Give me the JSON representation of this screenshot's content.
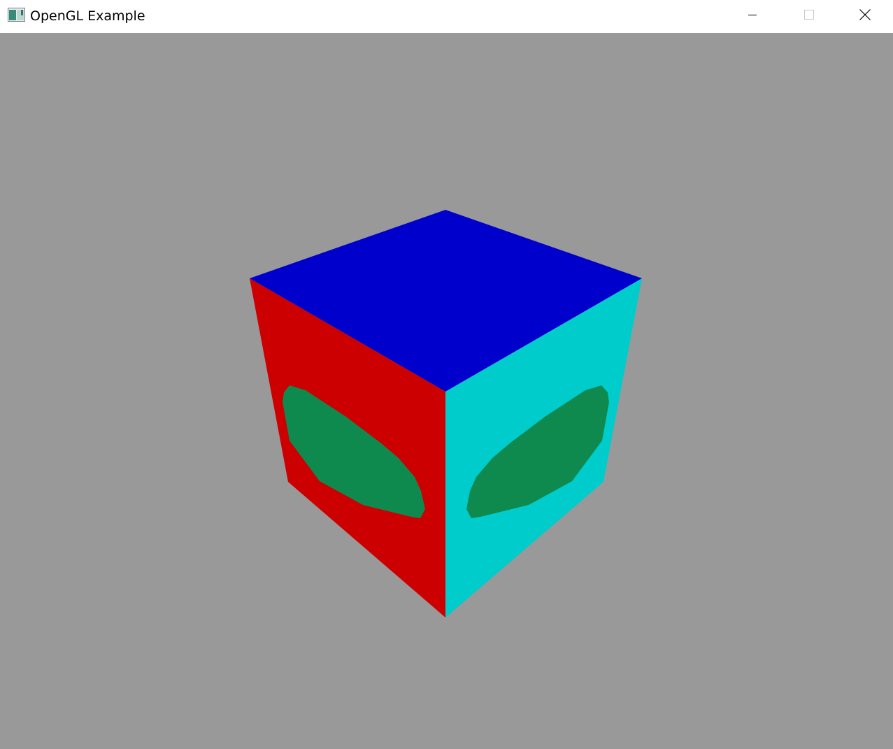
{
  "window": {
    "title": "OpenGL Example",
    "icon": "opengl-app-icon",
    "controls": {
      "minimize_icon": "minimize-icon",
      "maximize_icon": "maximize-icon",
      "close_icon": "close-icon"
    }
  },
  "scene": {
    "background_color": "#999999",
    "object": "cube",
    "faces": {
      "top": {
        "color": "#0000cc"
      },
      "left": {
        "color": "#cc0000"
      },
      "right": {
        "color": "#00cccc"
      },
      "left_marking": {
        "color": "#0e8a4f"
      },
      "right_marking": {
        "color": "#0e8a4f"
      }
    }
  }
}
